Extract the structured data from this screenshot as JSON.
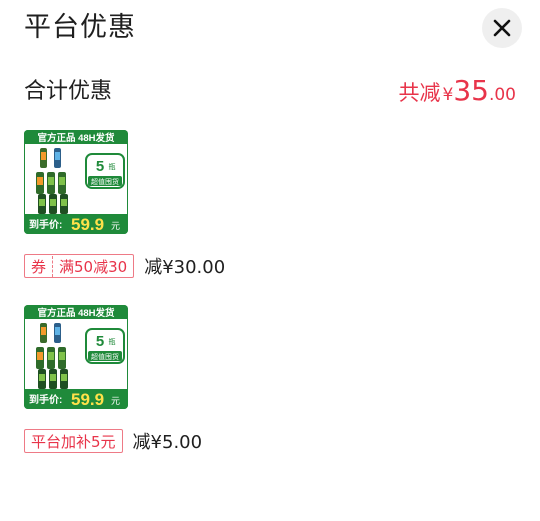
{
  "header": {
    "title": "平台优惠"
  },
  "summary": {
    "label": "合计优惠",
    "prefix": "共减",
    "currency": "¥",
    "amount_int": "35",
    "amount_dec": ".00"
  },
  "items": [
    {
      "product": {
        "top_banner": "官方正品 48H发货",
        "badge_number": "5",
        "badge_unit": "瓶",
        "badge_text": "超值囤货",
        "price_label": "到手价:",
        "price_int": "59.9",
        "price_unit": "元"
      },
      "tag_type": "券",
      "tag_text": "满50减30",
      "amount": "减¥30.00"
    },
    {
      "product": {
        "top_banner": "官方正品 48H发货",
        "badge_number": "5",
        "badge_unit": "瓶",
        "badge_text": "超值囤货",
        "price_label": "到手价:",
        "price_int": "59.9",
        "price_unit": "元"
      },
      "tag_text": "平台加补5元",
      "amount": "减¥5.00"
    }
  ],
  "colors": {
    "accent": "#e8344a",
    "product_green": "#1f8a3a",
    "price_yellow": "#ffe14a"
  }
}
